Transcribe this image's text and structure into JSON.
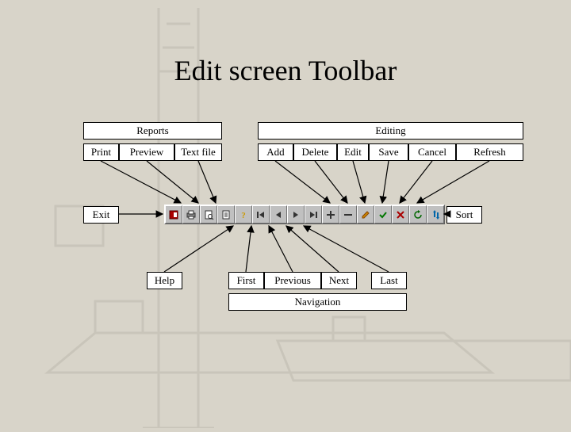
{
  "title": "Edit screen Toolbar",
  "groups": {
    "reports": "Reports",
    "editing": "Editing",
    "navigation": "Navigation"
  },
  "top": {
    "print": "Print",
    "preview": "Preview",
    "textfile": "Text file",
    "add": "Add",
    "delete": "Delete",
    "edit": "Edit",
    "save": "Save",
    "cancel": "Cancel",
    "refresh": "Refresh"
  },
  "side": {
    "exit": "Exit",
    "sort": "Sort"
  },
  "bottom": {
    "help": "Help",
    "first": "First",
    "previous": "Previous",
    "next": "Next",
    "last": "Last"
  },
  "toolbar_icons": [
    "exit-icon",
    "print-icon",
    "preview-icon",
    "textfile-icon",
    "help-icon",
    "first-icon",
    "previous-icon",
    "next-icon",
    "last-icon",
    "add-icon",
    "delete-icon",
    "edit-icon",
    "save-icon",
    "cancel-icon",
    "refresh-icon",
    "sort-icon"
  ]
}
